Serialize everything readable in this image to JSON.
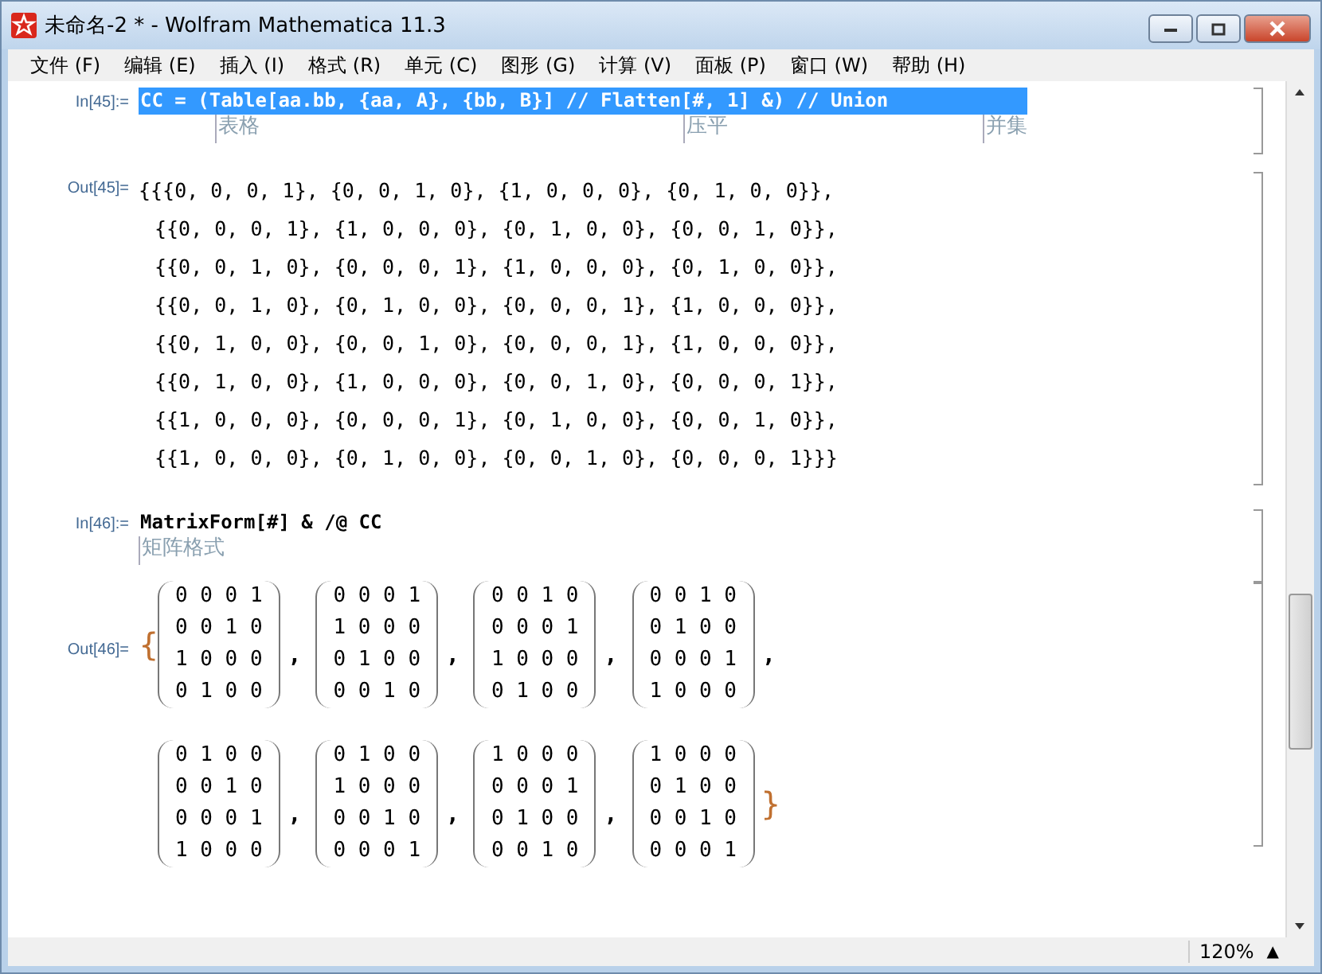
{
  "window": {
    "title": "未命名-2 * - Wolfram Mathematica 11.3"
  },
  "menu": [
    "文件 (F)",
    "编辑 (E)",
    "插入 (I)",
    "格式 (R)",
    "单元 (C)",
    "图形 (G)",
    "计算 (V)",
    "面板 (P)",
    "窗口 (W)",
    "帮助 (H)"
  ],
  "cell45": {
    "in_label": "In[45]:=",
    "input": "CC = (Table[aa.bb, {aa, A}, {bb, B}] // Flatten[#, 1] &) // Union",
    "selected": true,
    "hints": [
      "表格",
      "压平",
      "并集"
    ],
    "out_label": "Out[45]=",
    "output_lines": [
      "{{{0, 0, 0, 1}, {0, 0, 1, 0}, {1, 0, 0, 0}, {0, 1, 0, 0}},",
      "{{0, 0, 0, 1}, {1, 0, 0, 0}, {0, 1, 0, 0}, {0, 0, 1, 0}},",
      "{{0, 0, 1, 0}, {0, 0, 0, 1}, {1, 0, 0, 0}, {0, 1, 0, 0}},",
      "{{0, 0, 1, 0}, {0, 1, 0, 0}, {0, 0, 0, 1}, {1, 0, 0, 0}},",
      "{{0, 1, 0, 0}, {0, 0, 1, 0}, {0, 0, 0, 1}, {1, 0, 0, 0}},",
      "{{0, 1, 0, 0}, {1, 0, 0, 0}, {0, 0, 1, 0}, {0, 0, 0, 1}},",
      "{{1, 0, 0, 0}, {0, 0, 0, 1}, {0, 1, 0, 0}, {0, 0, 1, 0}},",
      "{{1, 0, 0, 0}, {0, 1, 0, 0}, {0, 0, 1, 0}, {0, 0, 0, 1}}}"
    ]
  },
  "cell46": {
    "in_label": "In[46]:=",
    "input": "MatrixForm[#] & /@ CC",
    "hints": [
      "矩阵格式"
    ],
    "out_label": "Out[46]=",
    "open": "{",
    "separator": ",",
    "close": "}",
    "matrix_rows": [
      [
        [
          "0 0 0 1",
          "0 0 1 0",
          "1 0 0 0",
          "0 1 0 0"
        ],
        [
          "0 0 0 1",
          "1 0 0 0",
          "0 1 0 0",
          "0 0 1 0"
        ],
        [
          "0 0 1 0",
          "0 0 0 1",
          "1 0 0 0",
          "0 1 0 0"
        ],
        [
          "0 0 1 0",
          "0 1 0 0",
          "0 0 0 1",
          "1 0 0 0"
        ]
      ],
      [
        [
          "0 1 0 0",
          "0 0 1 0",
          "0 0 0 1",
          "1 0 0 0"
        ],
        [
          "0 1 0 0",
          "1 0 0 0",
          "0 0 1 0",
          "0 0 0 1"
        ],
        [
          "1 0 0 0",
          "0 0 0 1",
          "0 1 0 0",
          "0 0 1 0"
        ],
        [
          "1 0 0 0",
          "0 1 0 0",
          "0 0 1 0",
          "0 0 0 1"
        ]
      ]
    ]
  },
  "status_bar": {
    "zoom": "120%",
    "zoom_arrow": "▲"
  }
}
